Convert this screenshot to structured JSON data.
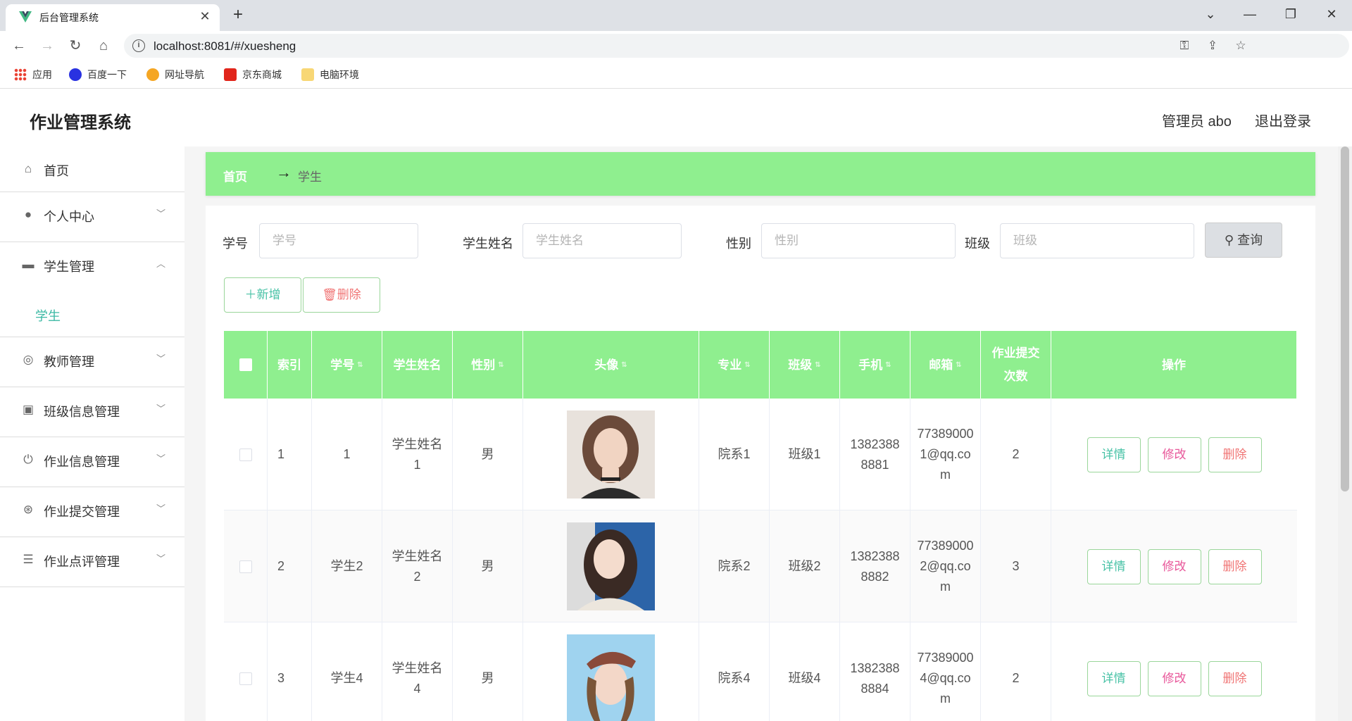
{
  "browser": {
    "tab_title": "后台管理系统",
    "tab_close": "✕",
    "new_tab": "+",
    "url": "localhost:8081/#/xuesheng",
    "bookmarks": [
      {
        "label": "应用",
        "icon": "apps-grid-icon"
      },
      {
        "label": "百度一下",
        "icon": "baidu-paw-icon"
      },
      {
        "label": "网址导航",
        "icon": "nav-icon"
      },
      {
        "label": "京东商城",
        "icon": "jd-icon"
      },
      {
        "label": "电脑环境",
        "icon": "folder-icon"
      }
    ]
  },
  "header": {
    "title": "作业管理系统",
    "admin": "管理员 abo",
    "logout": "退出登录"
  },
  "sidebar": {
    "items": [
      {
        "label": "首页",
        "icon": "home-icon"
      },
      {
        "label": "个人中心",
        "icon": "user-icon"
      },
      {
        "label": "学生管理",
        "icon": "monitor-icon",
        "children": [
          "学生"
        ]
      },
      {
        "label": "教师管理",
        "icon": "target-icon"
      },
      {
        "label": "班级信息管理",
        "icon": "chart-icon"
      },
      {
        "label": "作业信息管理",
        "icon": "power-icon"
      },
      {
        "label": "作业提交管理",
        "icon": "aperture-icon"
      },
      {
        "label": "作业点评管理",
        "icon": "sliders-icon"
      }
    ]
  },
  "breadcrumb": {
    "home": "首页",
    "separator": "→",
    "current": "学生"
  },
  "search": {
    "fields": [
      {
        "label": "学号",
        "placeholder": "学号"
      },
      {
        "label": "学生姓名",
        "placeholder": "学生姓名"
      },
      {
        "label": "性别",
        "placeholder": "性别"
      },
      {
        "label": "班级",
        "placeholder": "班级"
      }
    ],
    "button": "查询"
  },
  "actions": {
    "add": "新增",
    "delete": "删除"
  },
  "table": {
    "columns": [
      "索引",
      "学号",
      "学生姓名",
      "性别",
      "头像",
      "专业",
      "班级",
      "手机",
      "邮箱",
      "作业提交次数",
      "操作"
    ],
    "rows": [
      {
        "index": "1",
        "xuehao": "1",
        "name": "学生姓名1",
        "gender": "男",
        "major": "院系1",
        "class": "班级1",
        "phone": "13823888881",
        "email": "773890001@qq.com",
        "submits": "2"
      },
      {
        "index": "2",
        "xuehao": "学生2",
        "name": "学生姓名2",
        "gender": "男",
        "major": "院系2",
        "class": "班级2",
        "phone": "13823888882",
        "email": "773890002@qq.com",
        "submits": "3"
      },
      {
        "index": "3",
        "xuehao": "学生4",
        "name": "学生姓名4",
        "gender": "男",
        "major": "院系4",
        "class": "班级4",
        "phone": "13823888884",
        "email": "773890004@qq.com",
        "submits": "2"
      }
    ],
    "op_labels": {
      "detail": "详情",
      "edit": "修改",
      "delete": "删除"
    }
  },
  "colors": {
    "accent_green": "#8fef8f",
    "teal": "#48c2a6",
    "pink": "#e8579a",
    "red": "#f07575"
  }
}
